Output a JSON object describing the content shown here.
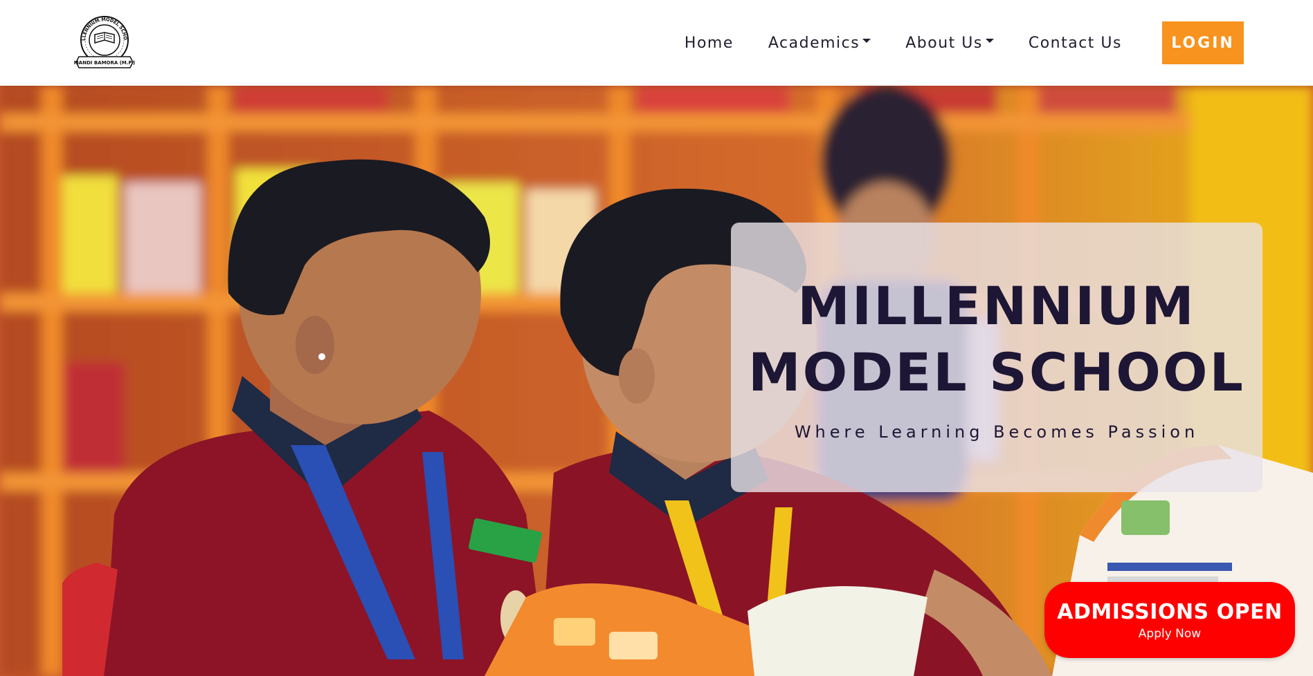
{
  "navbar": {
    "logo": {
      "ring_text": "MILLENNIUM MODEL SCHOOL",
      "banner_text": "MANDI BAMORA (M.P.)"
    },
    "items": [
      {
        "label": "Home",
        "dropdown": false
      },
      {
        "label": "Academics",
        "dropdown": true
      },
      {
        "label": "About Us",
        "dropdown": true
      },
      {
        "label": "Contact Us",
        "dropdown": false
      }
    ],
    "login_label": "LOGIN"
  },
  "hero": {
    "title_line1": "MILLENNIUM",
    "title_line2": "MODEL SCHOOL",
    "tagline": "Where Learning Becomes Passion",
    "image_alt": "students-reading-in-library-photo"
  },
  "admissions": {
    "title": "ADMISSIONS OPEN",
    "subtitle": "Apply Now"
  },
  "colors": {
    "login_bg": "#f7931e",
    "admissions_bg": "#ff0000",
    "title_text": "#1d1634",
    "nav_text": "#1f1f2e"
  }
}
